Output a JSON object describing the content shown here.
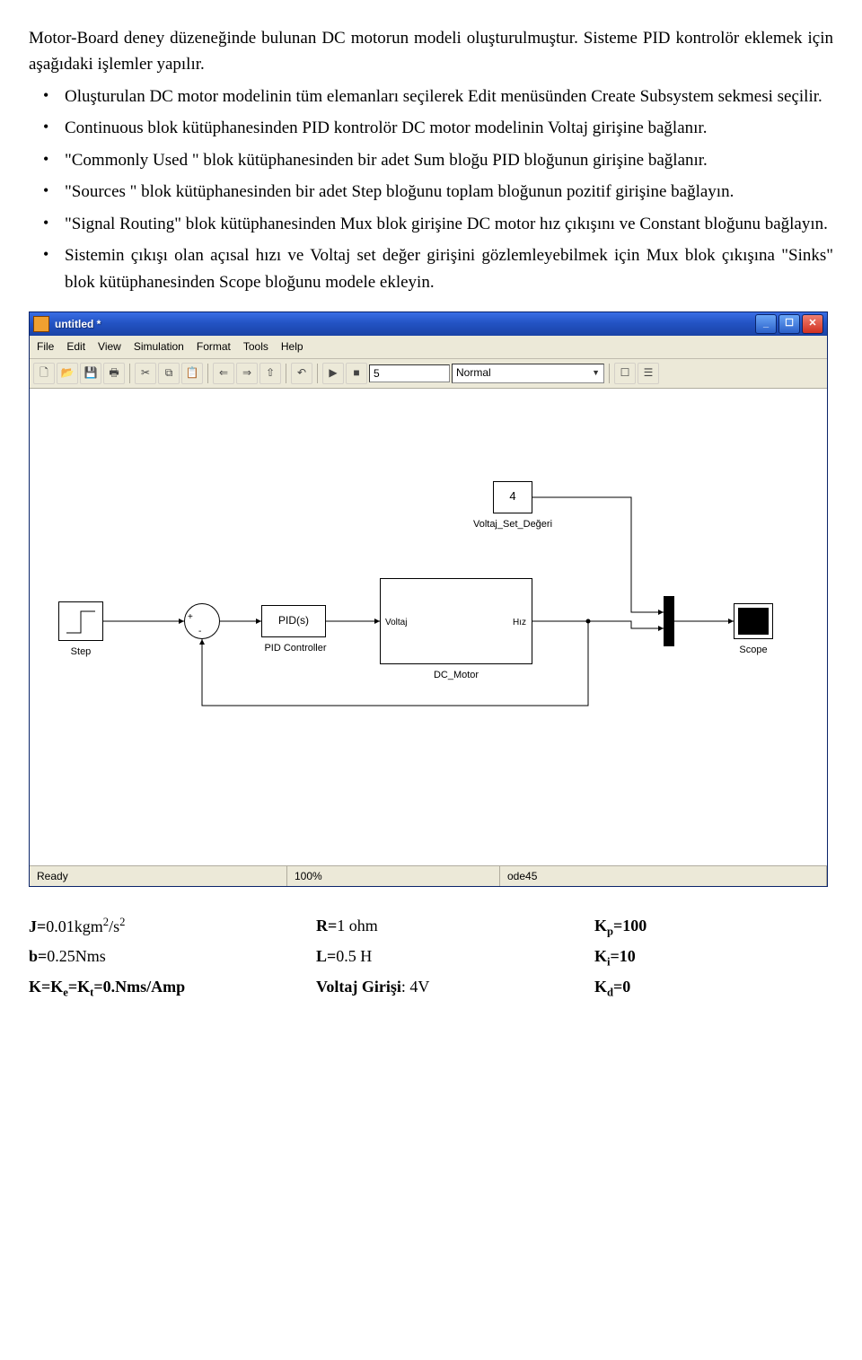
{
  "intro": "Motor-Board deney düzeneğinde bulunan DC motorun modeli oluşturulmuştur. Sisteme PID kontrolör eklemek için aşağıdaki işlemler yapılır.",
  "bullets": [
    "Oluşturulan DC motor modelinin tüm elemanları seçilerek Edit menüsünden Create Subsystem sekmesi seçilir.",
    "Continuous blok kütüphanesinden PID kontrolör DC motor modelinin Voltaj girişine bağlanır.",
    "\"Commonly Used \" blok kütüphanesinden bir adet Sum bloğu PID bloğunun girişine bağlanır.",
    "\"Sources \" blok kütüphanesinden bir adet Step bloğunu toplam bloğunun pozitif girişine bağlayın.",
    "\"Signal Routing\" blok kütüphanesinden Mux blok girişine DC motor hız çıkışını ve Constant bloğunu bağlayın.",
    "Sistemin çıkışı olan açısal hızı ve Voltaj set değer girişini gözlemleyebilmek için Mux blok çıkışına \"Sinks\" blok kütüphanesinden Scope bloğunu modele ekleyin."
  ],
  "window": {
    "title": "untitled *",
    "menus": [
      "File",
      "Edit",
      "View",
      "Simulation",
      "Format",
      "Tools",
      "Help"
    ],
    "stop_time": "5",
    "mode": "Normal",
    "status": {
      "ready": "Ready",
      "zoom": "100%",
      "solver": "ode45"
    }
  },
  "blocks": {
    "step": "Step",
    "pid_text": "PID(s)",
    "pid_label": "PID Controller",
    "dc_in": "Voltaj",
    "dc_out": "Hız",
    "dc_label": "DC_Motor",
    "const_val": "4",
    "const_label": "Voltaj_Set_Değeri",
    "scope": "Scope"
  },
  "params": {
    "row1": {
      "c1_b": "J=",
      "c1_v": "0.01kgm",
      "c1_sup": "2",
      "c1_v2": "/s",
      "c1_sup2": "2",
      "c2_b": "R=",
      "c2_v": "1 ohm",
      "c3_b": "K",
      "c3_sub": "p",
      "c3_v": "=100"
    },
    "row2": {
      "c1_b": "b=",
      "c1_v": "0.25Nms",
      "c2_b": "L=",
      "c2_v": "0.5 H",
      "c3_b": "K",
      "c3_sub": "i",
      "c3_v": "=10"
    },
    "row3": {
      "c1_b": "K=K",
      "c1_sub": "e",
      "c1_v": "=K",
      "c1_sub2": "t",
      "c1_v2": "=0.Nms/Amp",
      "c2_b": "Voltaj Girişi",
      "c2_v": ": 4V",
      "c3_b": "K",
      "c3_sub": "d",
      "c3_v": "=0"
    }
  }
}
